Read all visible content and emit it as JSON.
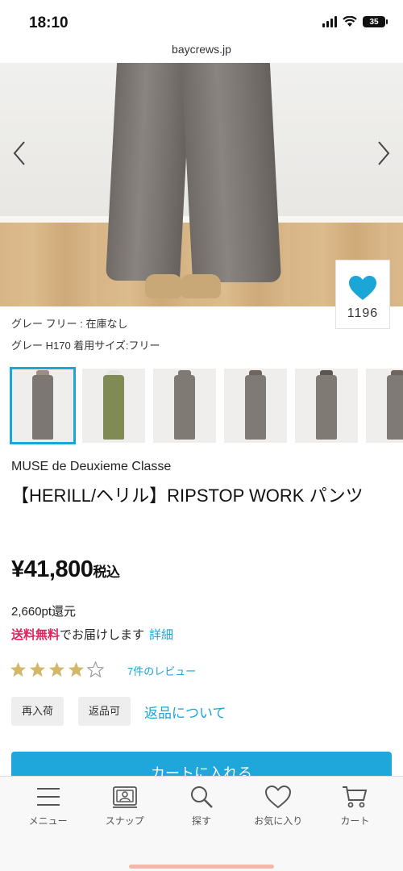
{
  "status_bar": {
    "time": "18:10",
    "battery": "35"
  },
  "browser": {
    "url": "baycrews.jp"
  },
  "product": {
    "like_count": "1196",
    "color_stock": "グレー フリー : 在庫なし",
    "model_info": "グレー H170 着用サイズ:フリー",
    "thumbnails": [
      {
        "color": "#7c7772"
      },
      {
        "color": "#7f8a55"
      },
      {
        "color": "#807a75"
      },
      {
        "color": "#807a75"
      },
      {
        "color": "#807a75"
      },
      {
        "color": "#807a75"
      }
    ],
    "brand": "MUSE de Deuxieme Classe",
    "title": "【HERILL/ヘリル】RIPSTOP WORK パンツ",
    "price": "¥41,800",
    "tax_label": "税込",
    "points": "2,660pt還元",
    "shipping_free": "送料無料",
    "shipping_text": "でお届けします",
    "shipping_detail": "詳細",
    "rating": 4,
    "rating_max": 5,
    "review_link": "7件のレビュー",
    "tags": [
      "再入荷",
      "返品可"
    ],
    "returns_link": "返品について",
    "cart_button": "カートに入れる"
  },
  "tabbar": {
    "items": [
      {
        "label": "メニュー",
        "icon": "menu-icon"
      },
      {
        "label": "スナップ",
        "icon": "snap-icon"
      },
      {
        "label": "探す",
        "icon": "search-icon"
      },
      {
        "label": "お気に入り",
        "icon": "heart-icon"
      },
      {
        "label": "カート",
        "icon": "cart-icon"
      }
    ]
  },
  "colors": {
    "accent": "#1aa6d6",
    "free_shipping": "#e0245e",
    "star": "#d4b86a"
  }
}
